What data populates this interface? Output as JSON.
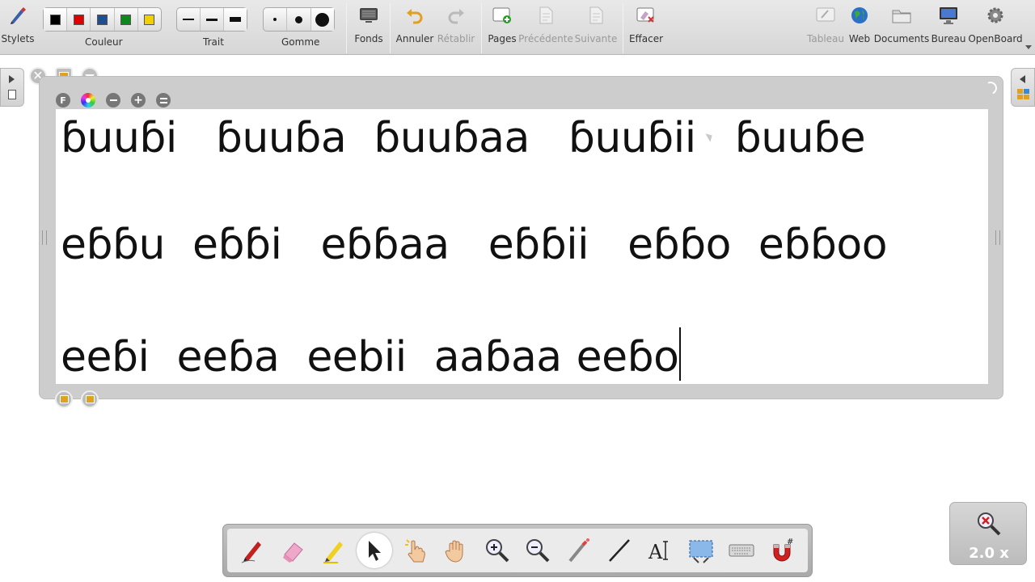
{
  "toolbar": {
    "stylets_label": "Stylets",
    "couleur_label": "Couleur",
    "trait_label": "Trait",
    "gomme_label": "Gomme",
    "fonds_label": "Fonds",
    "annuler_label": "Annuler",
    "retablir_label": "Rétablir",
    "pages_label": "Pages",
    "precedente_label": "Précédente",
    "suivante_label": "Suivante",
    "effacer_label": "Effacer",
    "tableau_label": "Tableau",
    "web_label": "Web",
    "documents_label": "Documents",
    "bureau_label": "Bureau",
    "openboard_label": "OpenBoard",
    "colors": [
      "#000000",
      "#e00000",
      "#1f4f8f",
      "#0a8a1a",
      "#f0d000"
    ],
    "selected_color": "#000000"
  },
  "widget": {
    "font_button_label": "F",
    "lines": [
      [
        "ɓuuɓi",
        "ɓuuɓa",
        "ɓuuɓaa",
        "ɓuuɓii",
        "ɓuuɓe"
      ],
      [
        "eɓɓu",
        "eɓɓi",
        "eɓɓaa",
        "eɓɓii",
        "eɓɓo",
        "eɓɓoo"
      ],
      [
        "eeɓi",
        "eeɓa",
        "eebii",
        "aaɓaa",
        "eeɓo"
      ]
    ]
  },
  "zoom": {
    "label": "2.0 x"
  }
}
